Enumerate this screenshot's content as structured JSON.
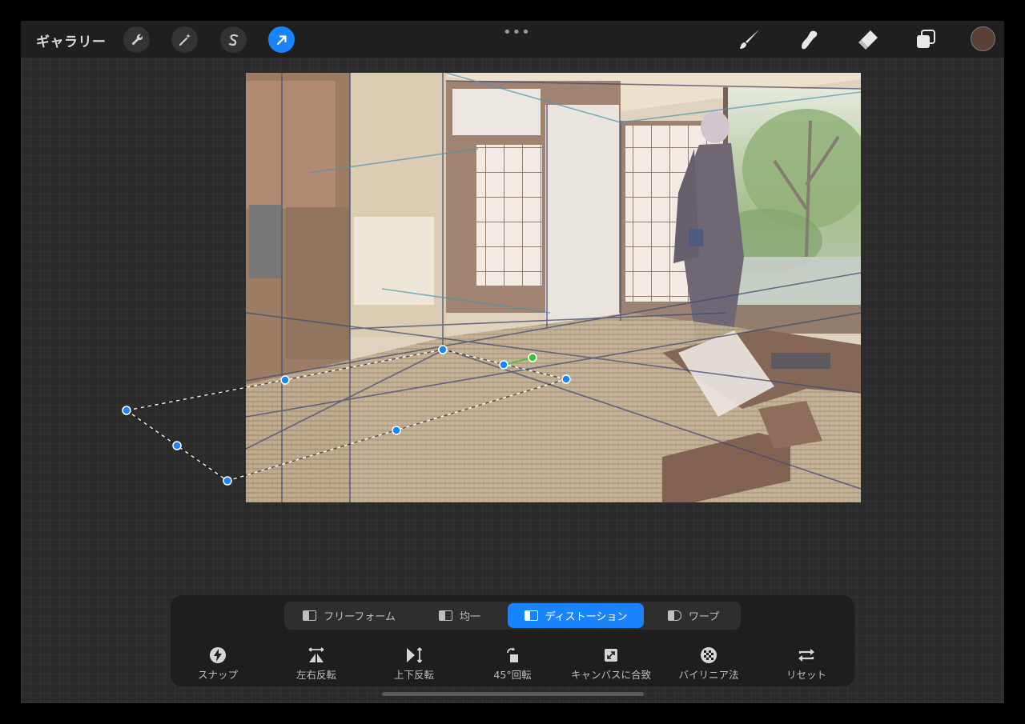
{
  "topbar": {
    "gallery_label": "ギャラリー",
    "more_glyph": "•••",
    "left_tools": [
      {
        "name": "wrench-icon"
      },
      {
        "name": "magic-wand-icon"
      },
      {
        "name": "selection-s-icon"
      },
      {
        "name": "transform-arrow-icon",
        "active": true
      }
    ],
    "right_tools": [
      "brush-icon",
      "smudge-icon",
      "eraser-icon",
      "layers-icon"
    ],
    "current_color": "#5a4035"
  },
  "accent_color": "#1a84ff",
  "transform": {
    "modes": [
      {
        "label": "フリーフォーム",
        "icon": "freeform-icon"
      },
      {
        "label": "均一",
        "icon": "uniform-icon"
      },
      {
        "label": "ディストーション",
        "icon": "distort-icon",
        "active": true
      },
      {
        "label": "ワープ",
        "icon": "warp-icon"
      }
    ],
    "actions": [
      {
        "label": "スナップ",
        "icon": "snap-bolt-icon"
      },
      {
        "label": "左右反転",
        "icon": "flip-horizontal-icon"
      },
      {
        "label": "上下反転",
        "icon": "flip-vertical-icon"
      },
      {
        "label": "45°回転",
        "icon": "rotate-45-icon"
      },
      {
        "label": "キャンバスに合致",
        "icon": "fit-to-canvas-icon"
      },
      {
        "label": "バイリニア法",
        "icon": "bilinear-icon"
      },
      {
        "label": "リセット",
        "icon": "reset-icon"
      }
    ]
  }
}
